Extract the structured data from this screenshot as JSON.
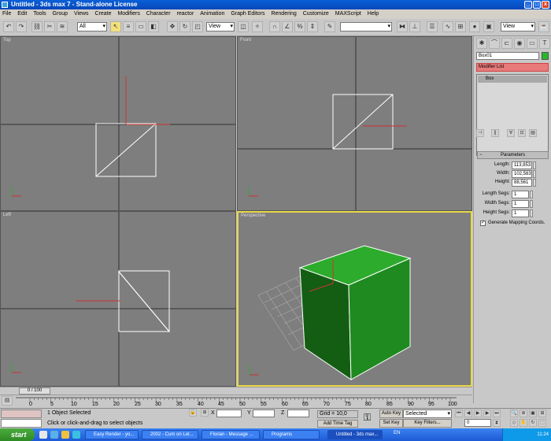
{
  "window": {
    "title": "Untitled   - 3ds max 7   - Stand-alone License",
    "min": "_",
    "max": "□",
    "close": "x"
  },
  "menu": [
    "File",
    "Edit",
    "Tools",
    "Group",
    "Views",
    "Create",
    "Modifiers",
    "Character",
    "reactor",
    "Animation",
    "Graph Editors",
    "Rendering",
    "Customize",
    "MAXScript",
    "Help"
  ],
  "toolbar": {
    "selection_filter": "All",
    "ref_coord": "View",
    "named_sel": "",
    "view_dropdown": "View"
  },
  "viewports": {
    "top": "Top",
    "front": "Front",
    "left": "Left",
    "perspective": "Perspective"
  },
  "command_panel": {
    "object_name": "Box01",
    "object_color": "#2ab82a",
    "modifier_list": "Modifier List",
    "stack_item": "Box",
    "rollout": "Parameters",
    "params": [
      {
        "label": "Length:",
        "value": "113,853"
      },
      {
        "label": "Width:",
        "value": "102,583"
      },
      {
        "label": "Height:",
        "value": "88,561"
      },
      {
        "label": "Length Segs:",
        "value": "1"
      },
      {
        "label": "Width Segs:",
        "value": "1"
      },
      {
        "label": "Height Segs:",
        "value": "1"
      }
    ],
    "gen_mapping": "Generate Mapping Coords."
  },
  "timeline": {
    "frame": "0 / 100",
    "ticks": [
      "0",
      "5",
      "10",
      "15",
      "20",
      "25",
      "30",
      "35",
      "40",
      "45",
      "50",
      "55",
      "60",
      "65",
      "70",
      "75",
      "80",
      "85",
      "90",
      "95",
      "100"
    ]
  },
  "status": {
    "selected": "1 Object Selected",
    "prompt": "Click or click-and-drag to select objects",
    "x_label": "X",
    "y_label": "Y",
    "z_label": "Z",
    "grid": "Grid = 10,0",
    "add_time_tag": "Add Time Tag",
    "auto_key": "Auto Key",
    "set_key": "Set Key",
    "selected_drop": "Selected",
    "key_filters": "Key Filters...",
    "frame_value": "0"
  },
  "taskbar": {
    "start": "start",
    "tasks": [
      "Easy Render - yo...",
      "2002 - Cum on Let...",
      "Florian - Message ...",
      "Programs",
      "Untitled - 3ds max..."
    ],
    "lang": "EN",
    "clock": "11:24"
  },
  "colors": {
    "box": "#1e8a1e",
    "highlight": "#e06a6a",
    "viewport_active": "#e8d848"
  }
}
